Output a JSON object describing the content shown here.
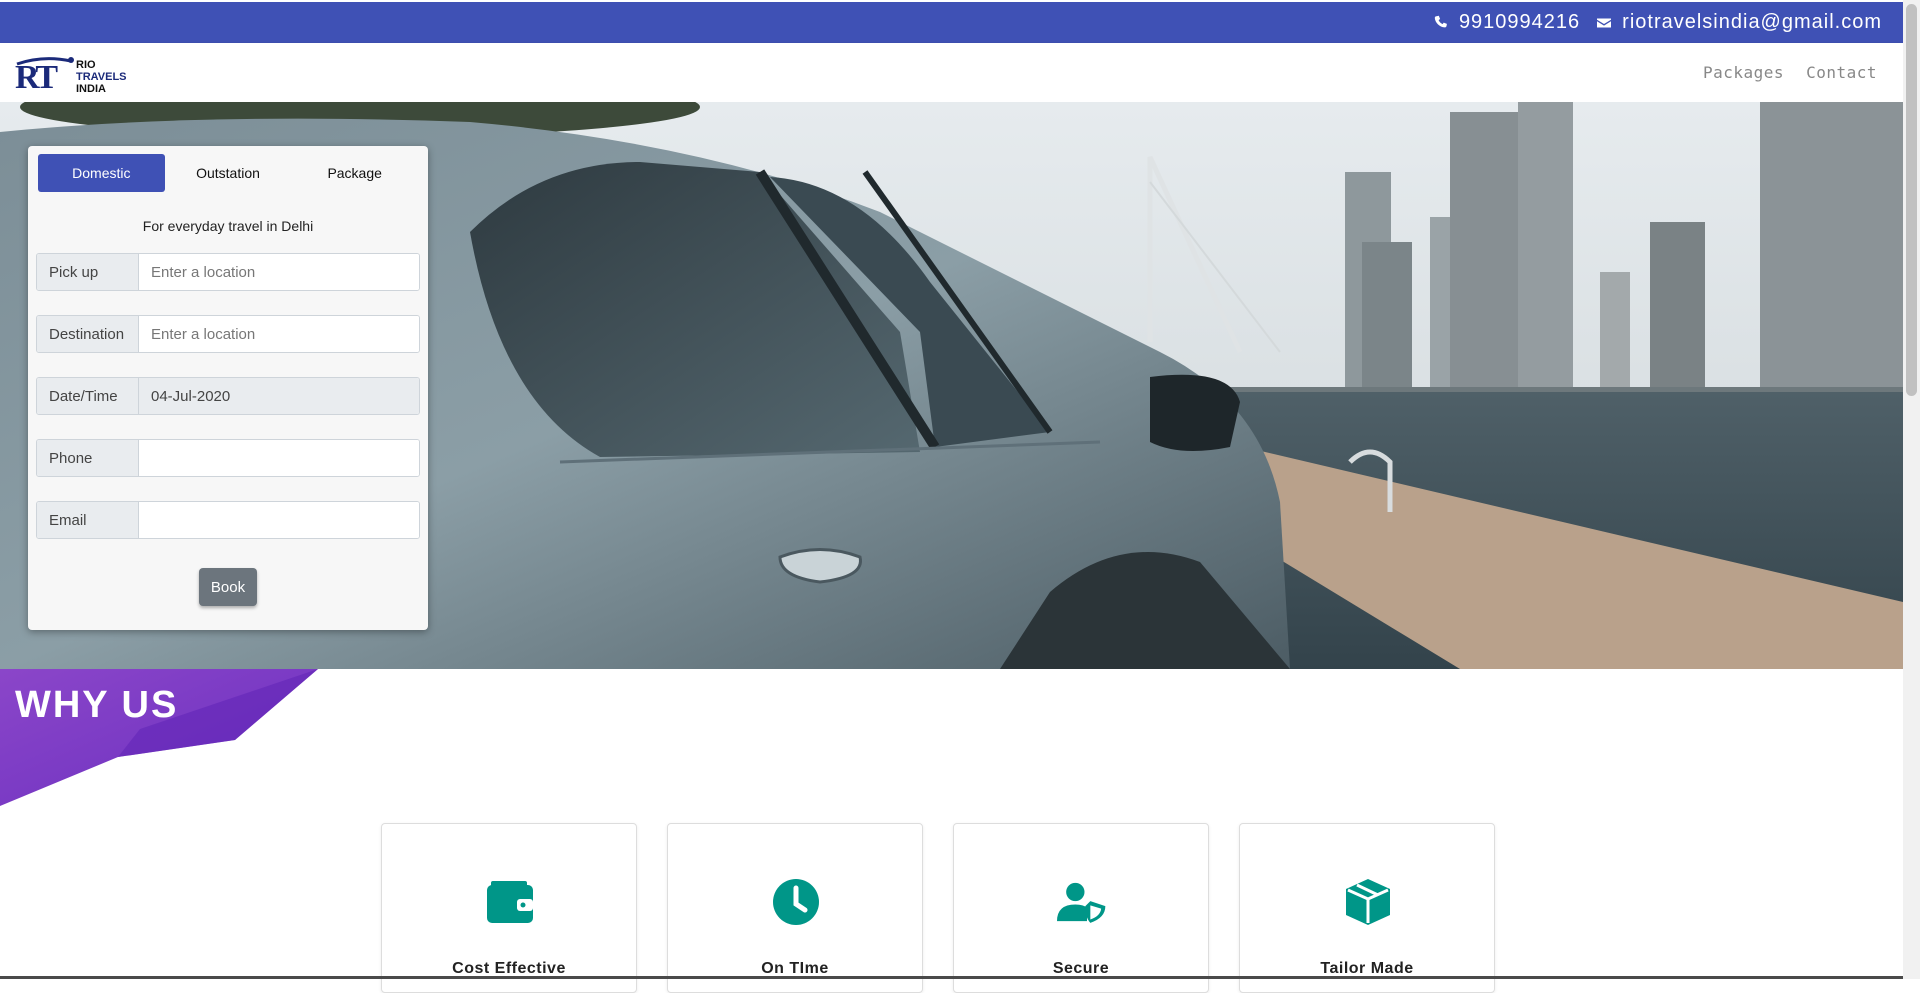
{
  "topbar": {
    "phone": "9910994216",
    "email": "riotravelsindia@gmail.com",
    "phone_icon": "phone-icon",
    "email_icon": "envelope-icon"
  },
  "brand": {
    "logo_line1": "RIO",
    "logo_line2": "TRAVELS",
    "logo_line3": "INDIA"
  },
  "nav": {
    "items": [
      {
        "label": "Packages"
      },
      {
        "label": "Contact"
      }
    ]
  },
  "booking": {
    "tabs": [
      {
        "label": "Domestic",
        "active": true
      },
      {
        "label": "Outstation",
        "active": false
      },
      {
        "label": "Package",
        "active": false
      }
    ],
    "subtitle": "For everyday travel in Delhi",
    "fields": {
      "pickup": {
        "label": "Pick up",
        "placeholder": "Enter a location",
        "value": ""
      },
      "destination": {
        "label": "Destination",
        "placeholder": "Enter a location",
        "value": ""
      },
      "datetime": {
        "label": "Date/Time",
        "value": "04-Jul-2020"
      },
      "phone": {
        "label": "Phone",
        "value": ""
      },
      "email": {
        "label": "Email",
        "value": ""
      }
    },
    "book_label": "Book"
  },
  "why_us": {
    "title": "WHY US",
    "features": [
      {
        "label": "Cost Effective",
        "icon": "wallet-icon"
      },
      {
        "label": "On TIme",
        "icon": "clock-icon"
      },
      {
        "label": "Secure",
        "icon": "user-shield-icon"
      },
      {
        "label": "Tailor Made",
        "icon": "box-icon"
      }
    ]
  },
  "colors": {
    "primary": "#3f51b5",
    "accent_teal": "#009688",
    "banner_purple": "#7b3fc4",
    "button_grey": "#6c757d"
  }
}
